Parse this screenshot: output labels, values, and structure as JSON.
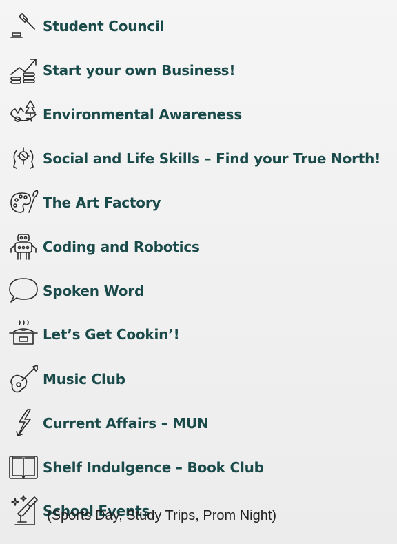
{
  "items": [
    {
      "icon": "gavel-icon",
      "label": "Student Council"
    },
    {
      "icon": "growth-chart-coins-icon",
      "label": "Start your own Business!"
    },
    {
      "icon": "earth-tree-icon",
      "label": "Environmental Awareness"
    },
    {
      "icon": "head-compass-icon",
      "label": "Social and Life Skills – Find your True North!"
    },
    {
      "icon": "paint-palette-brush-icon",
      "label": "The Art Factory"
    },
    {
      "icon": "robot-icon",
      "label": "Coding and Robotics"
    },
    {
      "icon": "speech-bubble-icon",
      "label": "Spoken Word"
    },
    {
      "icon": "cooking-pot-icon",
      "label": "Let’s Get Cookin’!"
    },
    {
      "icon": "guitar-icon",
      "label": "Music Club"
    },
    {
      "icon": "lightning-bolt-icon",
      "label": "Current Affairs – MUN"
    },
    {
      "icon": "open-book-icon",
      "label": "Shelf Indulgence – Book Club"
    },
    {
      "icon": "spotlight-stars-icon",
      "label": "School Events"
    }
  ],
  "school_events_detail": "(Sports Day, Study Trips, Prom Night)",
  "colors": {
    "label": "#1b4a4a",
    "icon_stroke": "#2a2a2a",
    "background": "#f0f0f0"
  }
}
